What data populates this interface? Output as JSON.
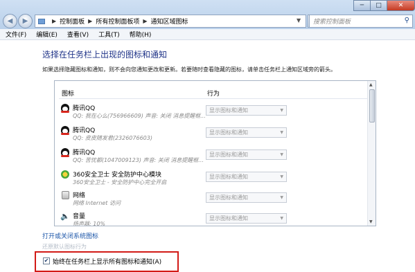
{
  "window": {
    "minimize": "─",
    "maximize": "□",
    "close": "✕"
  },
  "nav": {
    "back": "◀",
    "forward": "▶"
  },
  "address": {
    "crumbs": [
      "控制面板",
      "所有控制面板项",
      "通知区域图标"
    ]
  },
  "search": {
    "placeholder": "搜索控制面板"
  },
  "menu": {
    "items": [
      "文件(F)",
      "编辑(E)",
      "查看(V)",
      "工具(T)",
      "帮助(H)"
    ]
  },
  "main": {
    "heading": "选择在任务栏上出现的图标和通知",
    "description": "如果选择隐藏图标和通知，则不会向您通知更改和更新。若要随时查看隐藏的图标，请单击任务栏上通知区域旁的箭头。",
    "columns": {
      "icon": "图标",
      "behavior": "行为"
    },
    "rows": [
      {
        "icon": "qq-icon",
        "name": "腾讯QQ",
        "sub": "QQ: 我在心么(756966609)  声音: 关闭  消息提醒框...",
        "behavior": "显示图标和通知"
      },
      {
        "icon": "qq-icon",
        "name": "腾讯QQ",
        "sub": "QQ: 皮皮随发君(2326076603)",
        "behavior": "显示图标和通知"
      },
      {
        "icon": "qq-icon",
        "name": "腾讯QQ",
        "sub": "QQ: 苦忧都(1047009123)  声音: 关闭  消息提醒框...",
        "behavior": "显示图标和通知"
      },
      {
        "icon": "360-icon",
        "name": "360安全卫士 安全防护中心模块",
        "sub": "360安全卫士 - 安全防护中心完全开启",
        "behavior": "显示图标和通知"
      },
      {
        "icon": "network-icon",
        "name": "网络",
        "sub": "网络 Internet 访问",
        "behavior": "显示图标和通知"
      },
      {
        "icon": "volume-icon",
        "name": "音量",
        "sub": "扬声器: 10%",
        "behavior": "显示图标和通知"
      }
    ],
    "link_open_system_icons": "打开或关闭系统图标",
    "link_restore_default": "还原默认图标行为",
    "always_show_checked": "✔",
    "always_show_label": "始终在任务栏上显示所有图标和通知(A)"
  },
  "colors": {
    "heading": "#1e3287",
    "link": "#1b55a8",
    "highlight": "#d21a16"
  }
}
